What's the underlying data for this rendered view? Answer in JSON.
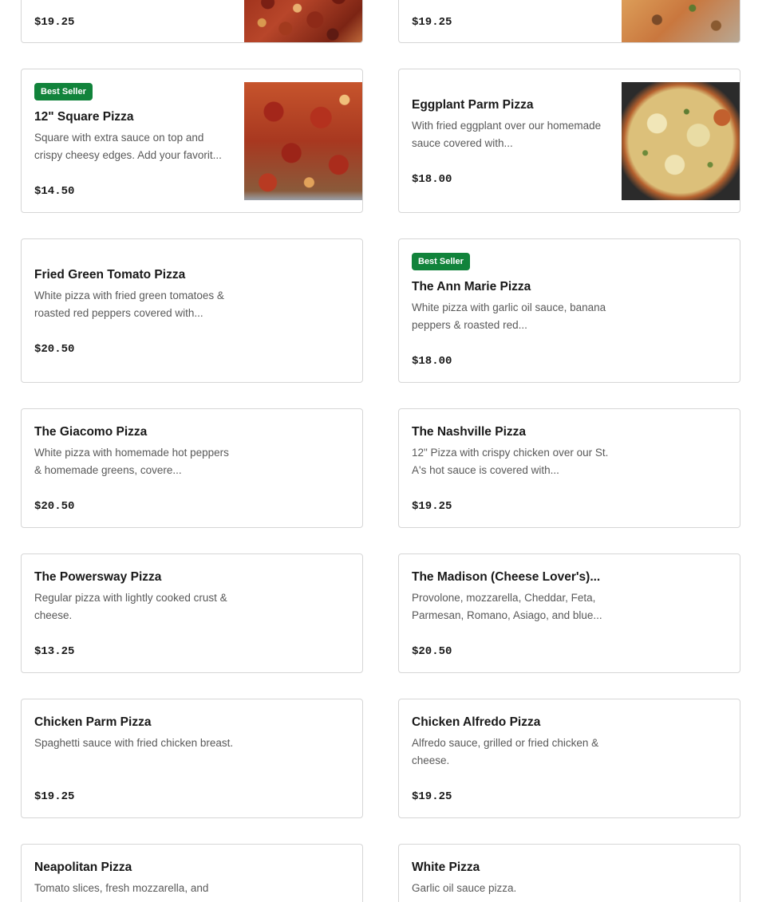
{
  "badge_label": "Best Seller",
  "items": [
    {
      "name": "",
      "description": "",
      "price": "$19.25",
      "image": "pizza-photo"
    },
    {
      "name": "",
      "description": "",
      "price": "$19.25",
      "image": "pizza-photo"
    },
    {
      "name": "12\" Square Pizza",
      "description": "Square with extra sauce on top and crispy cheesy edges. Add your favorit...",
      "price": "$14.50",
      "badge": "Best Seller",
      "image": "pizza-photo"
    },
    {
      "name": "Eggplant Parm Pizza",
      "description": "With fried eggplant over our homemade sauce covered with...",
      "price": "$18.00",
      "image": "pizza-photo"
    },
    {
      "name": "Fried Green Tomato Pizza",
      "description": "White pizza with fried green tomatoes & roasted red peppers covered with...",
      "price": "$20.50"
    },
    {
      "name": "The Ann Marie Pizza",
      "description": "White pizza with garlic oil sauce, banana peppers & roasted red...",
      "price": "$18.00",
      "badge": "Best Seller"
    },
    {
      "name": "The Giacomo Pizza",
      "description": "White pizza with homemade hot peppers & homemade greens, covere...",
      "price": "$20.50"
    },
    {
      "name": "The Nashville Pizza",
      "description": "12\" Pizza with crispy chicken over our St. A's hot sauce is covered with...",
      "price": "$19.25"
    },
    {
      "name": "The Powersway Pizza",
      "description": "Regular pizza with lightly cooked crust & cheese.",
      "price": "$13.25"
    },
    {
      "name": "The Madison (Cheese Lover's)...",
      "description": "Provolone, mozzarella, Cheddar, Feta, Parmesan, Romano, Asiago, and blue...",
      "price": "$20.50"
    },
    {
      "name": "Chicken Parm Pizza",
      "description": "Spaghetti sauce with fried chicken breast.",
      "price": "$19.25"
    },
    {
      "name": "Chicken Alfredo Pizza",
      "description": "Alfredo sauce, grilled or fried chicken & cheese.",
      "price": "$19.25"
    },
    {
      "name": "Neapolitan Pizza",
      "description": "Tomato slices, fresh mozzarella, and",
      "price": ""
    },
    {
      "name": "White Pizza",
      "description": "Garlic oil sauce pizza.",
      "price": ""
    }
  ],
  "colors": {
    "badge_bg": "#11833b",
    "border": "#d6d6d6",
    "desc": "#595959"
  }
}
